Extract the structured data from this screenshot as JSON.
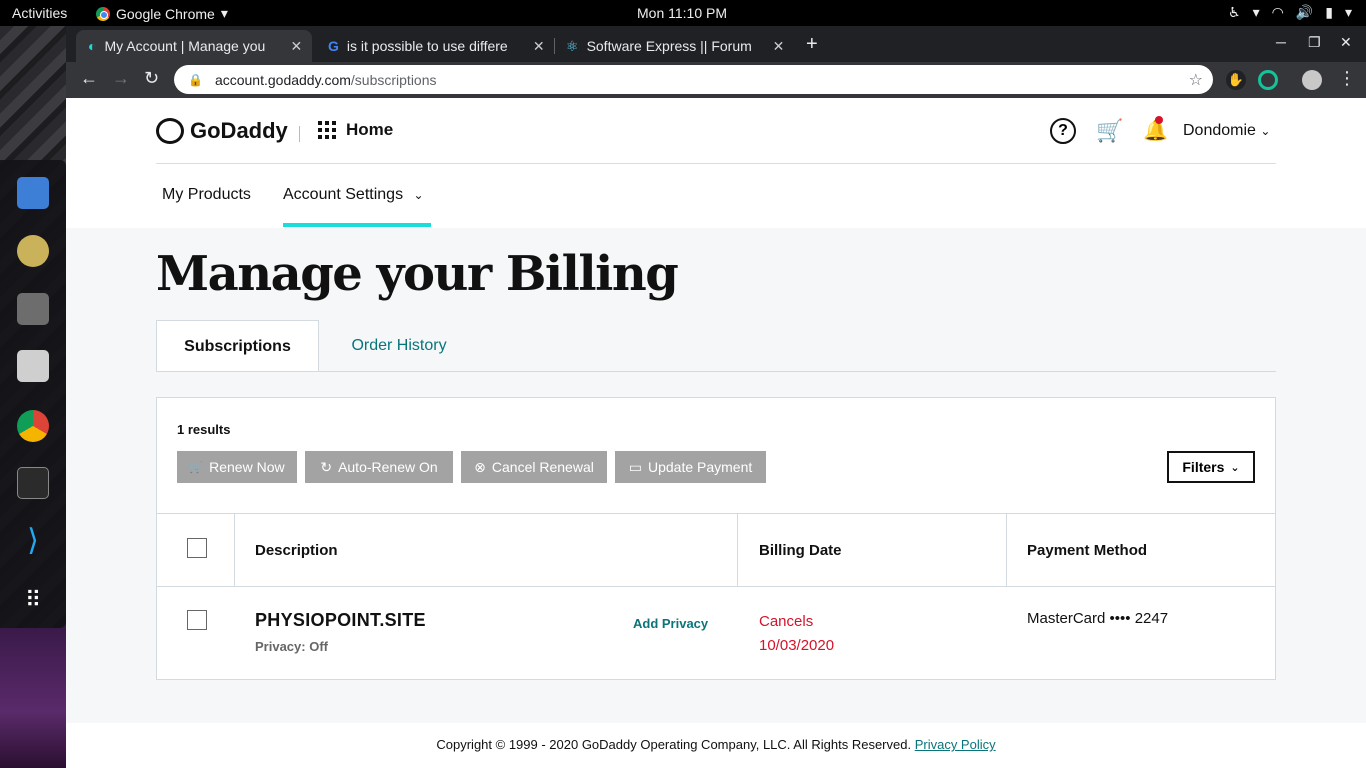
{
  "topbar": {
    "activities": "Activities",
    "app_name": "Google Chrome",
    "clock": "Mon 11:10 PM"
  },
  "browser": {
    "tabs": [
      {
        "title": "My Account | Manage you",
        "active": true
      },
      {
        "title": "is it possible to use differe",
        "active": false
      },
      {
        "title": "Software Express || Forum",
        "active": false
      }
    ],
    "url_host": "account.godaddy.com",
    "url_path": "/subscriptions"
  },
  "header": {
    "logo": "GoDaddy",
    "home": "Home",
    "user": "Dondomie",
    "help_glyph": "?"
  },
  "subnav": {
    "products": "My Products",
    "settings": "Account Settings"
  },
  "page": {
    "title": "Manage your Billing",
    "tab_subscriptions": "Subscriptions",
    "tab_order_history": "Order History",
    "results": "1 results"
  },
  "actions": {
    "renew": "Renew Now",
    "auto_renew": "Auto-Renew On",
    "cancel": "Cancel Renewal",
    "update_payment": "Update Payment",
    "filters": "Filters"
  },
  "table": {
    "headers": [
      "Description",
      "Billing Date",
      "Payment Method"
    ],
    "rows": [
      {
        "domain": "PHYSIOPOINT.SITE",
        "privacy": "Privacy: Off",
        "add_privacy": "Add Privacy",
        "billing_status": "Cancels",
        "billing_date": "10/03/2020",
        "payment": "MasterCard •••• 2247"
      }
    ]
  },
  "footer": {
    "copyright": "Copyright © 1999 - 2020 GoDaddy Operating Company, LLC. All Rights Reserved.",
    "privacy_link": "Privacy Policy"
  },
  "colors": {
    "accent_teal": "#09757a",
    "underline_cyan": "#1bdbdb",
    "cancel_red": "#d5132a",
    "disabled_button": "#a3a3a3"
  }
}
